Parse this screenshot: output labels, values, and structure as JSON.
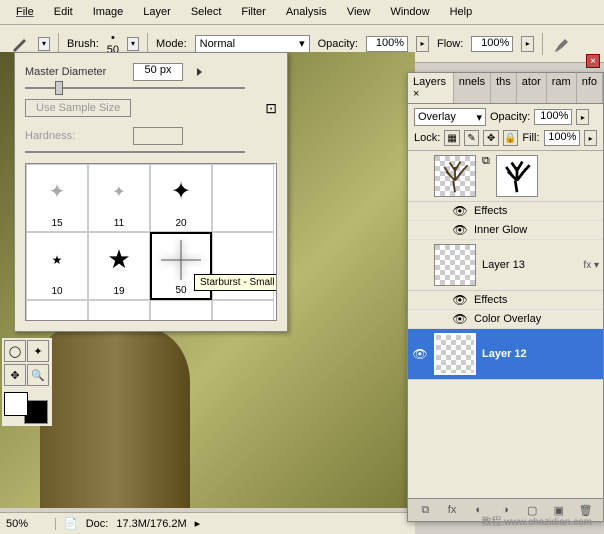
{
  "menu": [
    "File",
    "Edit",
    "Image",
    "Layer",
    "Select",
    "Filter",
    "Analysis",
    "View",
    "Window",
    "Help"
  ],
  "toolbar": {
    "brush_label": "Brush:",
    "brush_size": "50",
    "mode_label": "Mode:",
    "mode_value": "Normal",
    "opacity_label": "Opacity:",
    "opacity_value": "100%",
    "flow_label": "Flow:",
    "flow_value": "100%"
  },
  "brush_panel": {
    "diameter_label": "Master Diameter",
    "diameter_value": "50 px",
    "sample_btn": "Use Sample Size",
    "hardness_label": "Hardness:",
    "cells": [
      {
        "num": "15"
      },
      {
        "num": "11"
      },
      {
        "num": "20"
      },
      {
        "num": ""
      },
      {
        "num": "10"
      },
      {
        "num": "19"
      },
      {
        "num": "50"
      },
      {
        "num": ""
      }
    ],
    "tooltip": "Starburst - Small"
  },
  "layers": {
    "tabs": [
      "Layers",
      "nnels",
      "ths",
      "ator",
      "ram",
      "nfo"
    ],
    "blend_mode": "Overlay",
    "opacity_label": "Opacity:",
    "opacity_value": "100%",
    "lock_label": "Lock:",
    "fill_label": "Fill:",
    "fill_value": "100%",
    "items": {
      "tree_layer": "",
      "effects_label": "Effects",
      "inner_glow": "Inner Glow",
      "layer13": "Layer 13",
      "color_overlay": "Color Overlay",
      "layer12": "Layer 12"
    }
  },
  "status": {
    "zoom": "50%",
    "doc_label": "Doc:",
    "doc_value": "17.3M/176.2M"
  },
  "watermark": "教程.www.chazidian.com"
}
